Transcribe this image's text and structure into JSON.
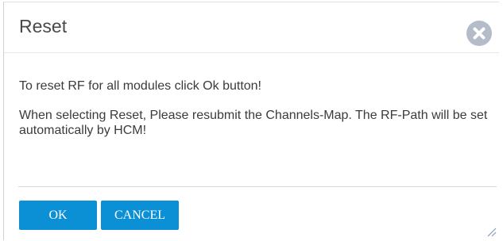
{
  "dialog": {
    "title": "Reset",
    "close_icon": "close-circle-icon",
    "message_line1": "To reset RF for all modules click Ok button!",
    "message_line2": "When selecting Reset, Please resubmit the Channels-Map. The RF-Path will be set automatically by HCM!",
    "ok_label": "OK",
    "cancel_label": "CANCEL",
    "resize_icon": "resize-grip-icon"
  },
  "colors": {
    "button_bg": "#0b90d6",
    "button_text": "#ffffff",
    "close_bg": "#b4bcc9",
    "title_text": "#4a4a4a",
    "body_text": "#3b3b3b"
  }
}
